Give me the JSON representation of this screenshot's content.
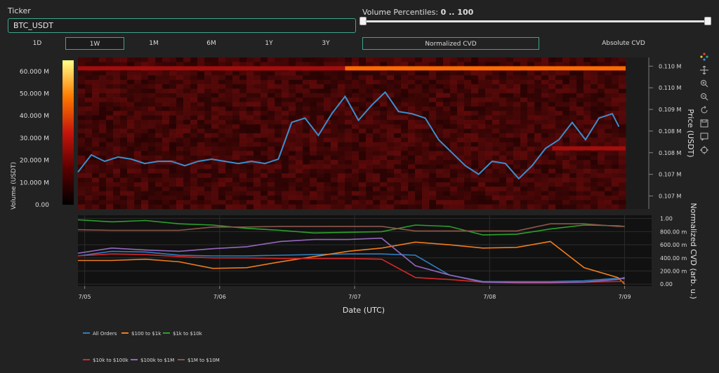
{
  "ticker": {
    "label": "Ticker",
    "value": "BTC_USDT"
  },
  "volume_percentiles": {
    "label": "Volume Percentiles: ",
    "range": "0 .. 100",
    "low": 0,
    "high": 100
  },
  "timeframes": [
    "1D",
    "1W",
    "1M",
    "6M",
    "1Y",
    "3Y"
  ],
  "active_timeframe": "1W",
  "modes": [
    "Normalized CVD",
    "Absolute CVD"
  ],
  "active_mode": "Normalized CVD",
  "colors": {
    "accent": "#3fa58d",
    "price_line": "#3b8fd0",
    "background": "#222222"
  },
  "modebar_icons": [
    "plotly-logo-icon",
    "pan-icon",
    "zoom-in-icon",
    "zoom-out-icon",
    "reset-icon",
    "save-icon",
    "comment-icon",
    "crosshair-icon"
  ],
  "chart_data": [
    {
      "type": "heatmap",
      "title": "",
      "xlabel": "",
      "ylabel": "Price (USDT)",
      "colorbar_label": "Volume (USDT)",
      "colorbar_ticks": [
        "60.000 M",
        "50.000 M",
        "40.000 M",
        "30.000 M",
        "20.000 M",
        "10.000 M",
        "0.00"
      ],
      "colorbar_values": [
        60,
        50,
        40,
        30,
        20,
        10,
        0
      ],
      "y_ticks": [
        "0.110 M",
        "0.110 M",
        "0.109 M",
        "0.108 M",
        "0.108 M",
        "0.107 M",
        "0.107 M"
      ],
      "y_values": [
        0.1102,
        0.1097,
        0.1092,
        0.1087,
        0.1082,
        0.1077,
        0.1072
      ],
      "ylim": [
        0.1069,
        0.1104
      ],
      "price_series_name": "Price",
      "price_x": [
        0.0,
        0.1,
        0.2,
        0.3,
        0.4,
        0.5,
        0.6,
        0.7,
        0.8,
        0.9,
        1.0,
        1.1,
        1.2,
        1.3,
        1.4,
        1.5,
        1.6,
        1.7,
        1.8,
        1.9,
        2.0,
        2.1,
        2.2,
        2.3,
        2.4,
        2.5,
        2.6,
        2.7,
        2.8,
        2.9,
        3.0,
        3.1,
        3.2,
        3.3,
        3.4,
        3.5,
        3.6,
        3.7,
        3.8,
        3.9,
        4.0,
        4.05
      ],
      "price_y": [
        0.10775,
        0.10815,
        0.108,
        0.1081,
        0.10805,
        0.10795,
        0.108,
        0.108,
        0.1079,
        0.108,
        0.10805,
        0.108,
        0.10795,
        0.108,
        0.10795,
        0.10805,
        0.1089,
        0.109,
        0.1086,
        0.1091,
        0.1095,
        0.10895,
        0.1093,
        0.1096,
        0.10915,
        0.1091,
        0.109,
        0.1085,
        0.1082,
        0.1079,
        0.1077,
        0.108,
        0.10795,
        0.1076,
        0.1079,
        0.1083,
        0.1085,
        0.1089,
        0.1085,
        0.109,
        0.1091,
        0.1088
      ],
      "high_volume_bands": [
        {
          "price": 0.11015,
          "x_start": 0.0,
          "x_end": 2.0,
          "level": 20
        },
        {
          "price": 0.11015,
          "x_start": 2.0,
          "x_end": 4.1,
          "level": 55
        },
        {
          "price": 0.1083,
          "x_start": 3.55,
          "x_end": 4.1,
          "level": 25
        }
      ]
    },
    {
      "type": "line",
      "title": "",
      "xlabel": "Date (UTC)",
      "ylabel": "Normalized CVD (arb. u.)",
      "x_ticks": [
        "7/05",
        "7/06",
        "7/07",
        "7/08",
        "7/09"
      ],
      "x_tick_values": [
        0.05,
        1.05,
        2.05,
        3.05,
        4.05
      ],
      "xlim": [
        0.0,
        4.25
      ],
      "y_ticks": [
        "1.00",
        "800.00 m",
        "600.00 m",
        "400.00 m",
        "200.00 m",
        "0.00"
      ],
      "y_tick_values": [
        1.0,
        0.8,
        0.6,
        0.4,
        0.2,
        0.0
      ],
      "ylim": [
        -0.03,
        1.05
      ],
      "x": [
        0.0,
        0.25,
        0.5,
        0.75,
        1.0,
        1.25,
        1.5,
        1.75,
        2.0,
        2.25,
        2.5,
        2.75,
        3.0,
        3.25,
        3.5,
        3.75,
        4.0,
        4.05
      ],
      "series": [
        {
          "name": "All Orders",
          "color": "#2f7fc0",
          "values": [
            0.43,
            0.5,
            0.49,
            0.44,
            0.43,
            0.43,
            0.44,
            0.45,
            0.46,
            0.46,
            0.44,
            0.14,
            0.04,
            0.04,
            0.04,
            0.05,
            0.09,
            0.08
          ]
        },
        {
          "name": "$100 to $1k",
          "color": "#ef7c1c",
          "values": [
            0.36,
            0.36,
            0.38,
            0.34,
            0.24,
            0.25,
            0.34,
            0.42,
            0.5,
            0.55,
            0.64,
            0.6,
            0.55,
            0.56,
            0.65,
            0.25,
            0.1,
            0.0
          ]
        },
        {
          "name": "$1k to $10k",
          "color": "#2ca02c",
          "values": [
            0.98,
            0.95,
            0.97,
            0.92,
            0.9,
            0.85,
            0.82,
            0.78,
            0.79,
            0.8,
            0.9,
            0.88,
            0.75,
            0.76,
            0.84,
            0.9,
            0.89,
            0.88
          ]
        },
        {
          "name": "$10k to $100k",
          "color": "#d62728",
          "values": [
            0.43,
            0.46,
            0.45,
            0.42,
            0.4,
            0.4,
            0.39,
            0.39,
            0.39,
            0.38,
            0.1,
            0.07,
            0.03,
            0.03,
            0.03,
            0.03,
            0.04,
            0.04
          ]
        },
        {
          "name": "$100k to $1M",
          "color": "#9467bd",
          "values": [
            0.47,
            0.55,
            0.52,
            0.5,
            0.54,
            0.57,
            0.65,
            0.68,
            0.68,
            0.7,
            0.28,
            0.14,
            0.03,
            0.02,
            0.02,
            0.03,
            0.07,
            0.1
          ]
        },
        {
          "name": "$1M to $10M",
          "color": "#8c564b",
          "values": [
            0.83,
            0.82,
            0.82,
            0.82,
            0.87,
            0.87,
            0.88,
            0.88,
            0.88,
            0.88,
            0.81,
            0.81,
            0.81,
            0.81,
            0.92,
            0.92,
            0.88,
            0.88
          ]
        }
      ]
    }
  ]
}
